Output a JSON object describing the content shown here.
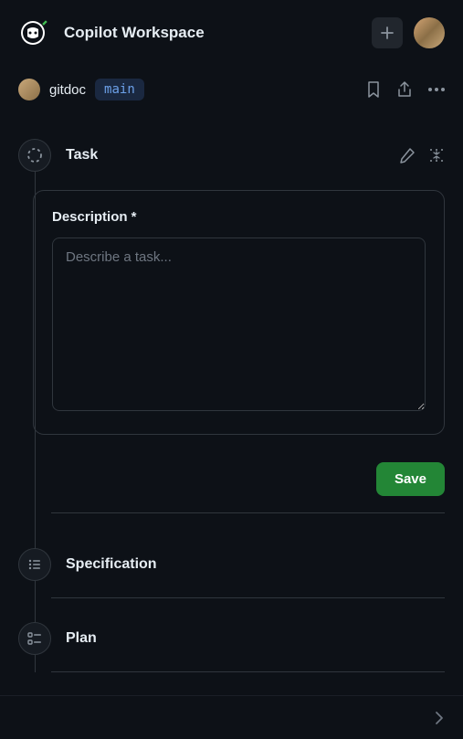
{
  "header": {
    "title": "Copilot Workspace"
  },
  "repo": {
    "name": "gitdoc",
    "branch": "main"
  },
  "task": {
    "title": "Task",
    "description_label": "Description *",
    "description_placeholder": "Describe a task...",
    "description_value": "",
    "save_label": "Save"
  },
  "steps": {
    "specification_label": "Specification",
    "plan_label": "Plan"
  }
}
